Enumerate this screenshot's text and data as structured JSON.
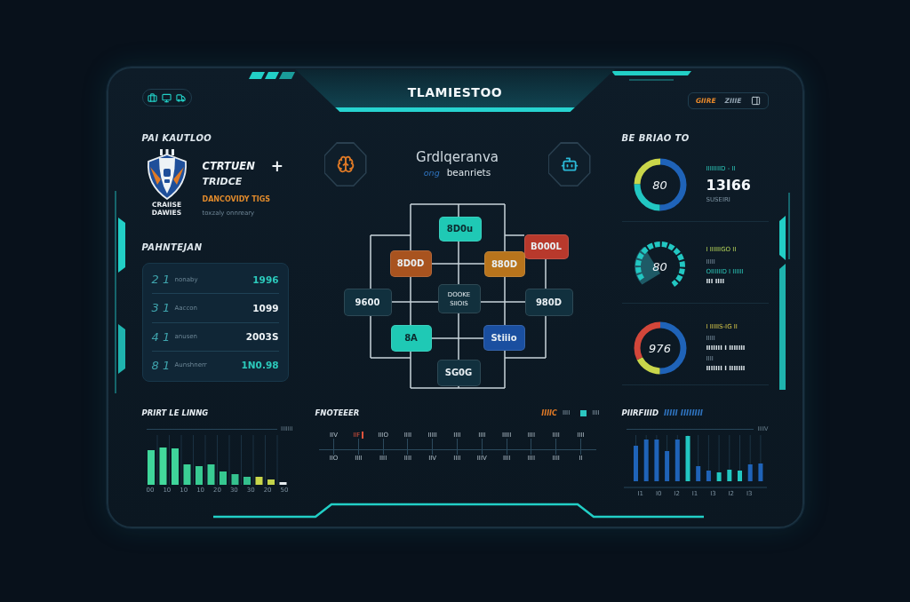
{
  "header": {
    "title": "TLAMIESTOO",
    "status": [
      {
        "label": "GIIRE",
        "color": "#e8892b"
      },
      {
        "label": "ZIIIE",
        "color": "#93a4b2"
      }
    ]
  },
  "profile": {
    "heading": "PAI KAUTLOO",
    "emblem_caption": "CRAIISE",
    "emblem_subcaption": "DAWIES",
    "name": "CTRTUEN",
    "action": "+",
    "subtitle": "TRIDCE",
    "tag": "DANCOVIDY TIGS",
    "note": "toxzaly onnreary"
  },
  "ranking": {
    "heading": "PAHNTEJAN",
    "rows": [
      {
        "rank": "2 1",
        "name": "nonaby",
        "value": "1996",
        "highlight": true
      },
      {
        "rank": "3 1",
        "name": "Aaccon",
        "value": "1099",
        "highlight": false
      },
      {
        "rank": "4 1",
        "name": "anusen",
        "value": "2003S",
        "highlight": false
      },
      {
        "rank": "8 1",
        "name": "Aunshnerr",
        "value": "1N0.98",
        "highlight": true
      }
    ]
  },
  "network": {
    "title": "Grdlqeranva",
    "subtitle_tag": "ong",
    "subtitle": "beanriets",
    "nodes": [
      {
        "label": "8D0u",
        "color": "#1fc9b5"
      },
      {
        "label": "B000L",
        "color": "#b8392c"
      },
      {
        "label": "8D0D",
        "color": "#a8531f"
      },
      {
        "label": "880D",
        "color": "#b8741c"
      },
      {
        "label": "9600",
        "color": "#11303e"
      },
      {
        "label": "DOOKE SIIOIS",
        "color": "#12303d"
      },
      {
        "label": "980D",
        "color": "#11303e"
      },
      {
        "label": "8A",
        "color": "#1fc9b5"
      },
      {
        "label": "Stiiio",
        "color": "#1a4fa0"
      },
      {
        "label": "SG0G",
        "color": "#11303e"
      }
    ]
  },
  "metrics": {
    "heading": "BE BRIAO TO",
    "cards": [
      {
        "kind": "donut",
        "center": "80",
        "lines": [
          {
            "kind": "label",
            "text": "IIIIIIIID - II"
          },
          {
            "kind": "value",
            "text": "13I66"
          },
          {
            "kind": "note",
            "text": "SUSEIRI"
          }
        ]
      },
      {
        "kind": "gauge",
        "center": "80",
        "lines": [
          {
            "kind": "label",
            "text": "I IIIIIIGO  II"
          },
          {
            "kind": "note",
            "text": "IIIII"
          },
          {
            "kind": "accent",
            "text": "OIIIIIID I IIIIII"
          },
          {
            "kind": "strong",
            "text": "III IIII"
          }
        ]
      },
      {
        "kind": "donut",
        "center": "976",
        "lines": [
          {
            "kind": "label",
            "text": "I IIIIIS-IG  II"
          },
          {
            "kind": "note",
            "text": "IIIII"
          },
          {
            "kind": "strong",
            "text": "IIIIIII I IIIIIII"
          },
          {
            "kind": "note",
            "text": "IIII"
          },
          {
            "kind": "strong",
            "text": "IIIIIII I IIIIIII"
          }
        ]
      }
    ]
  },
  "usage_chart": {
    "title": "PRIRT LE LINNG",
    "note": "IIIIIII",
    "axis_labels": [
      "00",
      "10",
      "10",
      "10",
      "20",
      "30",
      "30",
      "20",
      "50"
    ]
  },
  "timeline": {
    "title": "FNOTEEER",
    "legend": [
      {
        "kind": "text",
        "marker": "IIIIC",
        "label": "IIII",
        "color": "#e07a26"
      },
      {
        "kind": "swatch",
        "label": "IIII",
        "color": "#2bc6c0"
      }
    ],
    "columns": [
      {
        "top": "IIV",
        "bottom": "IIO",
        "marked": false
      },
      {
        "top": "IIF",
        "bottom": "IIII",
        "marked": true
      },
      {
        "top": "IIIO",
        "bottom": "IIII",
        "marked": false
      },
      {
        "top": "IIII",
        "bottom": "IIII",
        "marked": false
      },
      {
        "top": "IIIII",
        "bottom": "IIV",
        "marked": false
      },
      {
        "top": "IIII",
        "bottom": "IIII",
        "marked": false
      },
      {
        "top": "IIII",
        "bottom": "IIIV",
        "marked": false
      },
      {
        "top": "IIIII",
        "bottom": "IIII",
        "marked": false
      },
      {
        "top": "IIII",
        "bottom": "IIII",
        "marked": false
      },
      {
        "top": "IIII",
        "bottom": "IIII",
        "marked": false
      },
      {
        "top": "IIII",
        "bottom": "II",
        "marked": false
      }
    ]
  },
  "throughput_chart": {
    "title": "PIIRFIIID",
    "title_tag": "IIIII IIIIIIII",
    "note": "IIIIV",
    "axis_labels": [
      "I1",
      "I0",
      "I2",
      "I1",
      "I3",
      "I2",
      "I3"
    ]
  }
}
